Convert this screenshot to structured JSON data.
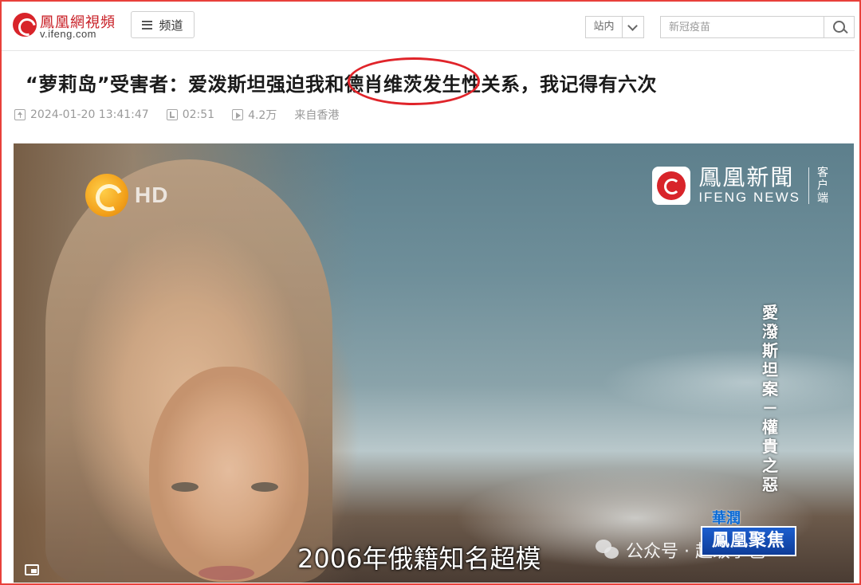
{
  "header": {
    "logo_cn": "鳳凰網視頻",
    "logo_en": "v.ifeng.com",
    "channel_label": "频道",
    "scope_label": "站内",
    "search_placeholder": "新冠疫苗"
  },
  "article": {
    "title": "“萝莉岛”受害者：爱泼斯坦强迫我和德肖维茨发生性关系，我记得有六次",
    "published": "2024-01-20 13:41:47",
    "duration": "02:51",
    "plays": "4.2万",
    "source": "来自香港"
  },
  "video": {
    "hd_label": "HD",
    "news_logo_cn": "鳳凰新聞",
    "news_logo_en": "IFENG NEWS",
    "news_logo_app": "客户端",
    "vertical_caption": "愛潑斯坦案－權貴之惡",
    "subtitle": "2006年俄籍知名超模",
    "show_sponsor": "華潤",
    "show_name": "鳳凰聚焦",
    "watermark": "公众号 · 超级学爸"
  },
  "colors": {
    "brand_red": "#d8242a",
    "frame_red": "#e8403a",
    "show_blue": "#1c5fcf"
  },
  "icons": {
    "logo": "ifeng-phoenix-icon",
    "channel": "hamburger-menu-icon",
    "scope": "chevron-down-icon",
    "search": "search-icon",
    "published": "upload-icon",
    "duration": "duration-icon",
    "plays": "play-count-icon",
    "watermark": "wechat-icon",
    "pip": "picture-in-picture-icon"
  }
}
